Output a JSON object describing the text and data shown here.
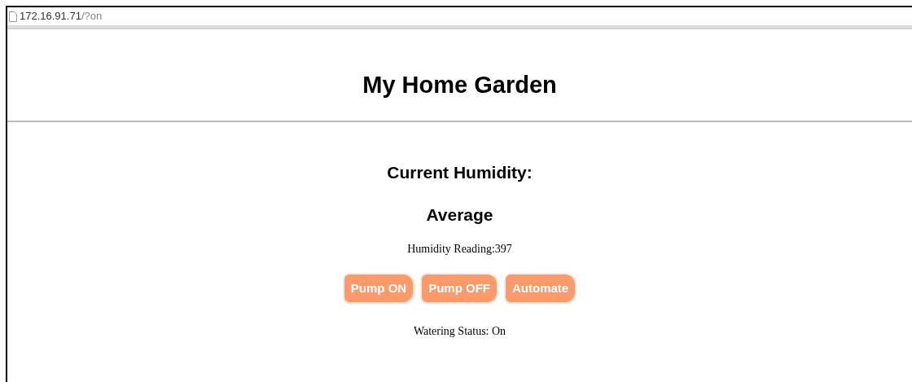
{
  "address_bar": {
    "host": "172.16.91.71",
    "path": "/?on"
  },
  "title": "My Home Garden",
  "humidity_heading": "Current Humidity:",
  "humidity_level": "Average",
  "reading": "Humidity Reading:397",
  "buttons": [
    "Pump ON",
    "Pump OFF",
    "Automate"
  ],
  "watering_status": "Watering Status: On"
}
